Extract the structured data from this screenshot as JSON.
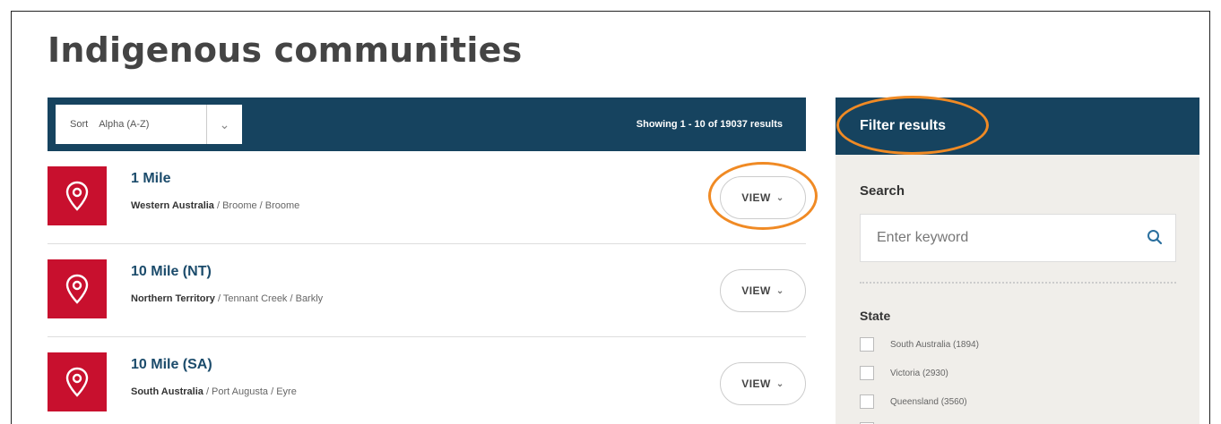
{
  "page": {
    "title": "Indigenous communities"
  },
  "toolbar": {
    "sort_label": "Sort",
    "sort_value": "Alpha (A-Z)",
    "sort_chevron": "⌄",
    "showing_text": "Showing 1 - 10 of 19037 results"
  },
  "results": [
    {
      "title": "1 Mile",
      "state": "Western Australia",
      "location": " / Broome / Broome",
      "view_label": "VIEW",
      "view_chevron": "⌄",
      "icon": "map-pin-icon"
    },
    {
      "title": "10 Mile (NT)",
      "state": "Northern Territory",
      "location": " / Tennant Creek / Barkly",
      "view_label": "VIEW",
      "view_chevron": "⌄",
      "icon": "map-pin-icon"
    },
    {
      "title": "10 Mile (SA)",
      "state": "South Australia",
      "location": " / Port Augusta / Eyre",
      "view_label": "VIEW",
      "view_chevron": "⌄",
      "icon": "map-pin-icon"
    }
  ],
  "filter": {
    "title": "Filter results",
    "search_label": "Search",
    "search_placeholder": "Enter keyword",
    "search_value": "",
    "state_label": "State",
    "states": [
      {
        "label": "South Australia (1894)",
        "checked": false
      },
      {
        "label": "Victoria (2930)",
        "checked": false
      },
      {
        "label": "Queensland (3560)",
        "checked": false
      }
    ]
  },
  "colors": {
    "header_bg": "#16435f",
    "pin_bg": "#c8102e",
    "panel_bg": "#f0eeea",
    "annotation": "#f08a24",
    "title_link": "#1b4b6b"
  }
}
